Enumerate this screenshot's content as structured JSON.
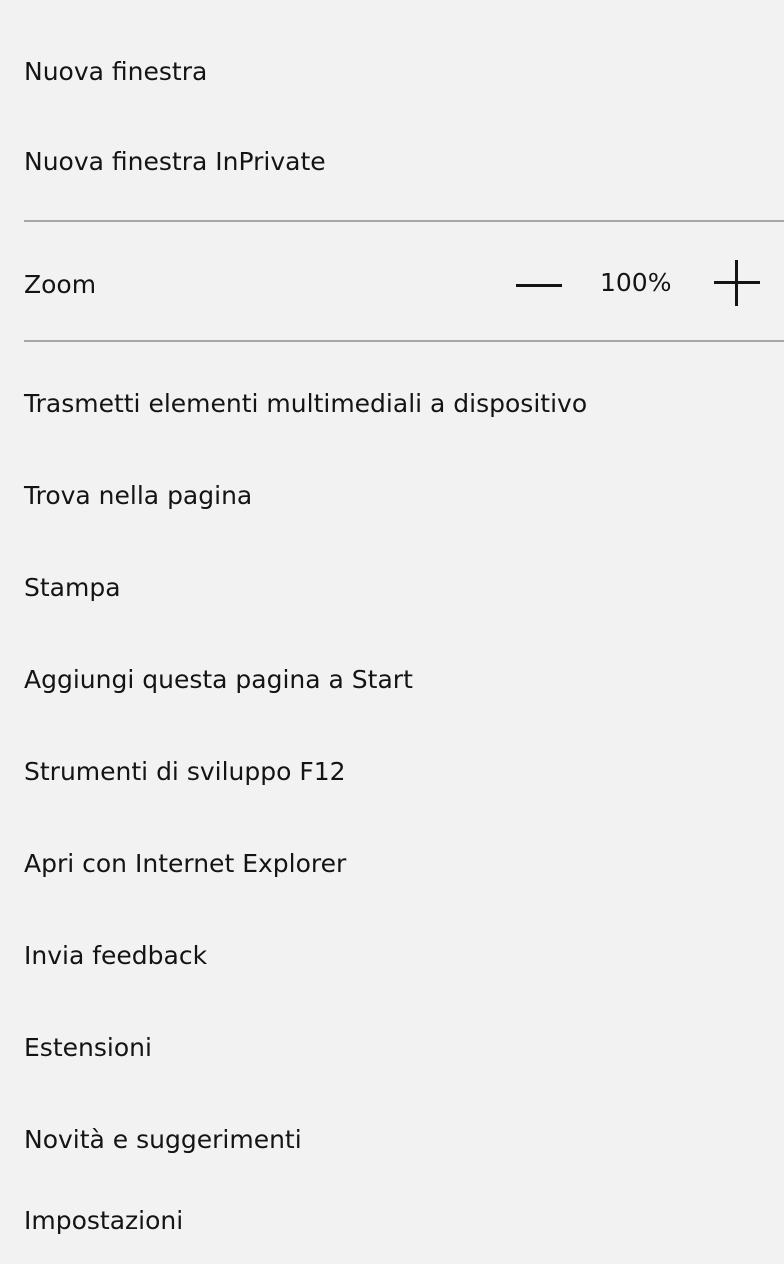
{
  "menu": {
    "new_window": "Nuova finestra",
    "new_inprivate_window": "Nuova finestra InPrivate",
    "zoom": {
      "label": "Zoom",
      "value": "100%",
      "decrease_icon": "minus-icon",
      "increase_icon": "plus-icon"
    },
    "items": [
      "Trasmetti elementi multimediali a dispositivo",
      "Trova nella pagina",
      "Stampa",
      "Aggiungi questa pagina a Start",
      "Strumenti di sviluppo F12",
      "Apri con Internet Explorer",
      "Invia feedback",
      "Estensioni",
      "Novità e suggerimenti",
      "Impostazioni"
    ]
  },
  "colors": {
    "background": "#f2f2f2",
    "text": "#141414",
    "divider": "#a7a7a7"
  }
}
